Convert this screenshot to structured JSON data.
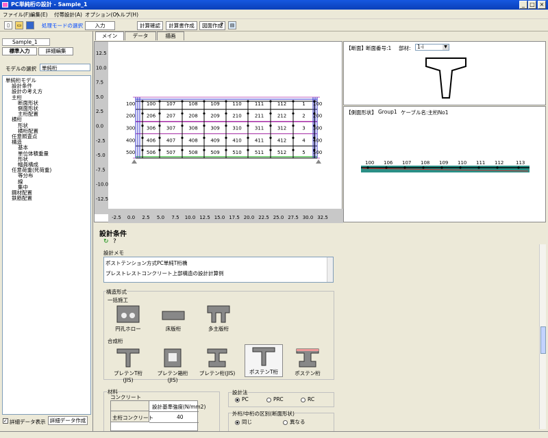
{
  "window": {
    "title": "PC単純桁の設計 - Sample_1",
    "min": "_",
    "max": "□",
    "close": "×"
  },
  "menu": [
    "ファイル(F)",
    "編集(E)",
    "付帯設計(A)",
    "オプション(O)",
    "ヘルプ(H)"
  ],
  "toolbar": {
    "icons": {
      "new": "new-file-icon",
      "open": "open-folder-icon",
      "save": "save-icon",
      "help": "help-icon",
      "about": "about-icon"
    },
    "mode_label": "処理モードの選択",
    "input": "入力",
    "calc_check": "計算確認",
    "report": "計算書作成",
    "drawing": "図面作成"
  },
  "sidebar": {
    "file": "Sample_1",
    "tab_standard": "標準入力",
    "tab_detail": "詳細編集",
    "model_label": "モデルの選択",
    "model_value": "単純桁",
    "tree": [
      {
        "t": "単純桁モデル",
        "d": 0,
        "e": "−"
      },
      {
        "t": "設計条件",
        "d": 1
      },
      {
        "t": "設計の考え方",
        "d": 1
      },
      {
        "t": "主桁",
        "d": 1,
        "e": "−"
      },
      {
        "t": "断面形状",
        "d": 2
      },
      {
        "t": "側面形状",
        "d": 2
      },
      {
        "t": "主桁配置",
        "d": 2
      },
      {
        "t": "横桁",
        "d": 1,
        "e": "−"
      },
      {
        "t": "形状",
        "d": 2
      },
      {
        "t": "横桁配置",
        "d": 2
      },
      {
        "t": "任意照査点",
        "d": 1
      },
      {
        "t": "構造",
        "d": 1,
        "e": "−"
      },
      {
        "t": "基本",
        "d": 2
      },
      {
        "t": "単位体積重量",
        "d": 2
      },
      {
        "t": "形状",
        "d": 2
      },
      {
        "t": "幅員構成",
        "d": 2
      },
      {
        "t": "任意荷重(死荷重)",
        "d": 1,
        "e": "−"
      },
      {
        "t": "等分布",
        "d": 2
      },
      {
        "t": "線",
        "d": 2
      },
      {
        "t": "集中",
        "d": 2
      },
      {
        "t": "鋼材配置",
        "d": 1
      },
      {
        "t": "鉄筋配置",
        "d": 1
      }
    ],
    "detail_check": "詳細データ表示",
    "detail_create": "詳細データ作成"
  },
  "tabs": [
    "メイン",
    "データ",
    "描画"
  ],
  "plot": {
    "y_ticks": [
      "12.5",
      "10.0",
      "7.5",
      "5.0",
      "2.5",
      "0.0",
      "-2.5",
      "-5.0",
      "-7.5",
      "-10.0",
      "-12.5"
    ],
    "x_ticks": [
      "-2.5",
      "0.0",
      "2.5",
      "5.0",
      "7.5",
      "10.0",
      "12.5",
      "15.0",
      "17.5",
      "20.0",
      "22.5",
      "25.0",
      "27.5",
      "30.0",
      "32.5"
    ],
    "rows": [
      [
        "100",
        "107",
        "108",
        "109",
        "110",
        "111",
        "112",
        "1"
      ],
      [
        "206",
        "207",
        "208",
        "209",
        "210",
        "211",
        "212",
        "2"
      ],
      [
        "306",
        "307",
        "308",
        "309",
        "310",
        "311",
        "312",
        "3"
      ],
      [
        "406",
        "407",
        "408",
        "409",
        "410",
        "411",
        "412",
        "4"
      ],
      [
        "506",
        "507",
        "508",
        "509",
        "510",
        "511",
        "512",
        "5"
      ]
    ],
    "row_left": [
      "100",
      "200",
      "300",
      "400",
      "500"
    ],
    "row_right": [
      "100",
      "200",
      "300",
      "400",
      "500"
    ]
  },
  "section": {
    "header": "【断面】",
    "number_label": "断面番号:1",
    "member_label": "部材:",
    "member_value": "1-i"
  },
  "profile": {
    "header": "【側面形状】",
    "group": "Group1",
    "cable": "ケーブル名:主桁No1",
    "nodes": [
      "100",
      "106",
      "107",
      "108",
      "109",
      "110",
      "111",
      "112",
      "113"
    ]
  },
  "form": {
    "title": "設計条件",
    "memo_label": "設計メモ",
    "memo_line1": "ポストテンション方式PC単純T桁橋",
    "memo_line2": "プレストレストコンクリート上部構造の設計計算例",
    "structure_label": "構造形式",
    "ikkatsu": "一括施工",
    "gousei": "合成桁",
    "shapes1": [
      "円孔ホロー",
      "床版桁",
      "多主版桁"
    ],
    "shapes2": [
      "プレテンT桁(JIS)",
      "プレテン箱桁(JIS)",
      "プレテン桁(JIS)",
      "ポステンT桁",
      "ポステン桁"
    ],
    "material_label": "材料",
    "concrete_label": "コンクリート",
    "strength_header": "設計基準強度(N/mm2)",
    "main_girder": "主桁コンクリート",
    "main_girder_value": "40",
    "design_method": "設計法",
    "methods": [
      "PC",
      "PRC",
      "RC"
    ],
    "diff_label": "外桁/中桁の区別(断面形状)",
    "diff_opts": [
      "同じ",
      "異なる"
    ]
  }
}
